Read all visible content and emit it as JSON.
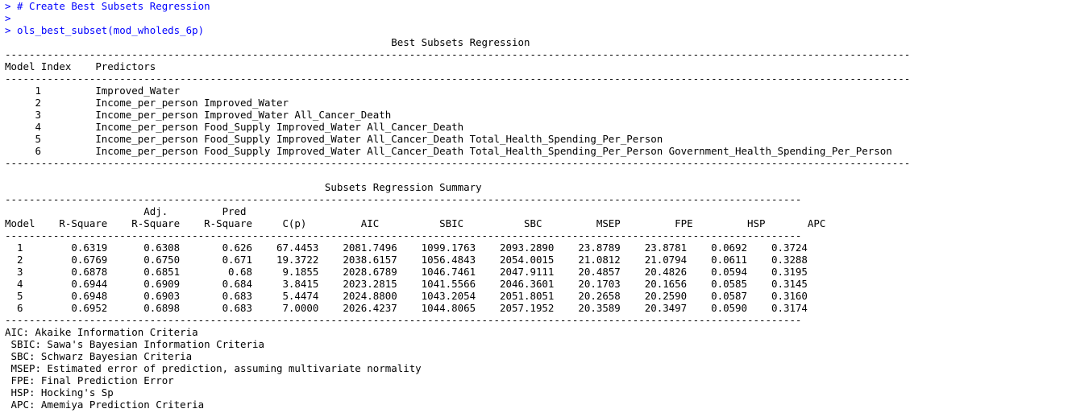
{
  "console": {
    "lines": [
      {
        "kind": "input",
        "text": "> # Create Best Subsets Regression"
      },
      {
        "kind": "input",
        "text": ">"
      },
      {
        "kind": "input",
        "text": "> ols_best_subset(mod_wholeds_6p)"
      },
      {
        "kind": "output",
        "text": "                                                                Best Subsets Regression"
      },
      {
        "kind": "output",
        "text": "------------------------------------------------------------------------------------------------------------------------------------------------------"
      },
      {
        "kind": "output",
        "text": "Model Index    Predictors"
      },
      {
        "kind": "output",
        "text": "------------------------------------------------------------------------------------------------------------------------------------------------------"
      },
      {
        "kind": "output",
        "text": "     1         Improved_Water"
      },
      {
        "kind": "output",
        "text": "     2         Income_per_person Improved_Water"
      },
      {
        "kind": "output",
        "text": "     3         Income_per_person Improved_Water All_Cancer_Death"
      },
      {
        "kind": "output",
        "text": "     4         Income_per_person Food_Supply Improved_Water All_Cancer_Death"
      },
      {
        "kind": "output",
        "text": "     5         Income_per_person Food_Supply Improved_Water All_Cancer_Death Total_Health_Spending_Per_Person"
      },
      {
        "kind": "output",
        "text": "     6         Income_per_person Food_Supply Improved_Water All_Cancer_Death Total_Health_Spending_Per_Person Government_Health_Spending_Per_Person"
      },
      {
        "kind": "output",
        "text": "------------------------------------------------------------------------------------------------------------------------------------------------------"
      },
      {
        "kind": "output",
        "text": ""
      },
      {
        "kind": "output",
        "text": "                                                     Subsets Regression Summary"
      },
      {
        "kind": "output",
        "text": "------------------------------------------------------------------------------------------------------------------------------------"
      },
      {
        "kind": "output",
        "text": "                       Adj.         Pred"
      },
      {
        "kind": "output",
        "text": "Model    R-Square    R-Square    R-Square     C(p)         AIC          SBIC          SBC         MSEP         FPE         HSP       APC"
      },
      {
        "kind": "output",
        "text": "------------------------------------------------------------------------------------------------------------------------------------"
      },
      {
        "kind": "output",
        "text": "  1        0.6319      0.6308       0.626    67.4453    2081.7496    1099.1763    2093.2890    23.8789    23.8781    0.0692    0.3724"
      },
      {
        "kind": "output",
        "text": "  2        0.6769      0.6750       0.671    19.3722    2038.6157    1056.4843    2054.0015    21.0812    21.0794    0.0611    0.3288"
      },
      {
        "kind": "output",
        "text": "  3        0.6878      0.6851        0.68     9.1855    2028.6789    1046.7461    2047.9111    20.4857    20.4826    0.0594    0.3195"
      },
      {
        "kind": "output",
        "text": "  4        0.6944      0.6909       0.684     3.8415    2023.2815    1041.5566    2046.3601    20.1703    20.1656    0.0585    0.3145"
      },
      {
        "kind": "output",
        "text": "  5        0.6948      0.6903       0.683     5.4474    2024.8800    1043.2054    2051.8051    20.2658    20.2590    0.0587    0.3160"
      },
      {
        "kind": "output",
        "text": "  6        0.6952      0.6898       0.683     7.0000    2026.4237    1044.8065    2057.1952    20.3589    20.3497    0.0590    0.3174"
      },
      {
        "kind": "output",
        "text": "------------------------------------------------------------------------------------------------------------------------------------"
      },
      {
        "kind": "output",
        "text": "AIC: Akaike Information Criteria"
      },
      {
        "kind": "output",
        "text": " SBIC: Sawa's Bayesian Information Criteria"
      },
      {
        "kind": "output",
        "text": " SBC: Schwarz Bayesian Criteria"
      },
      {
        "kind": "output",
        "text": " MSEP: Estimated error of prediction, assuming multivariate normality"
      },
      {
        "kind": "output",
        "text": " FPE: Final Prediction Error"
      },
      {
        "kind": "output",
        "text": " HSP: Hocking's Sp"
      },
      {
        "kind": "output",
        "text": " APC: Amemiya Prediction Criteria"
      }
    ]
  },
  "colors": {
    "input": "#0000ff",
    "output": "#000000",
    "background": "#ffffff"
  }
}
